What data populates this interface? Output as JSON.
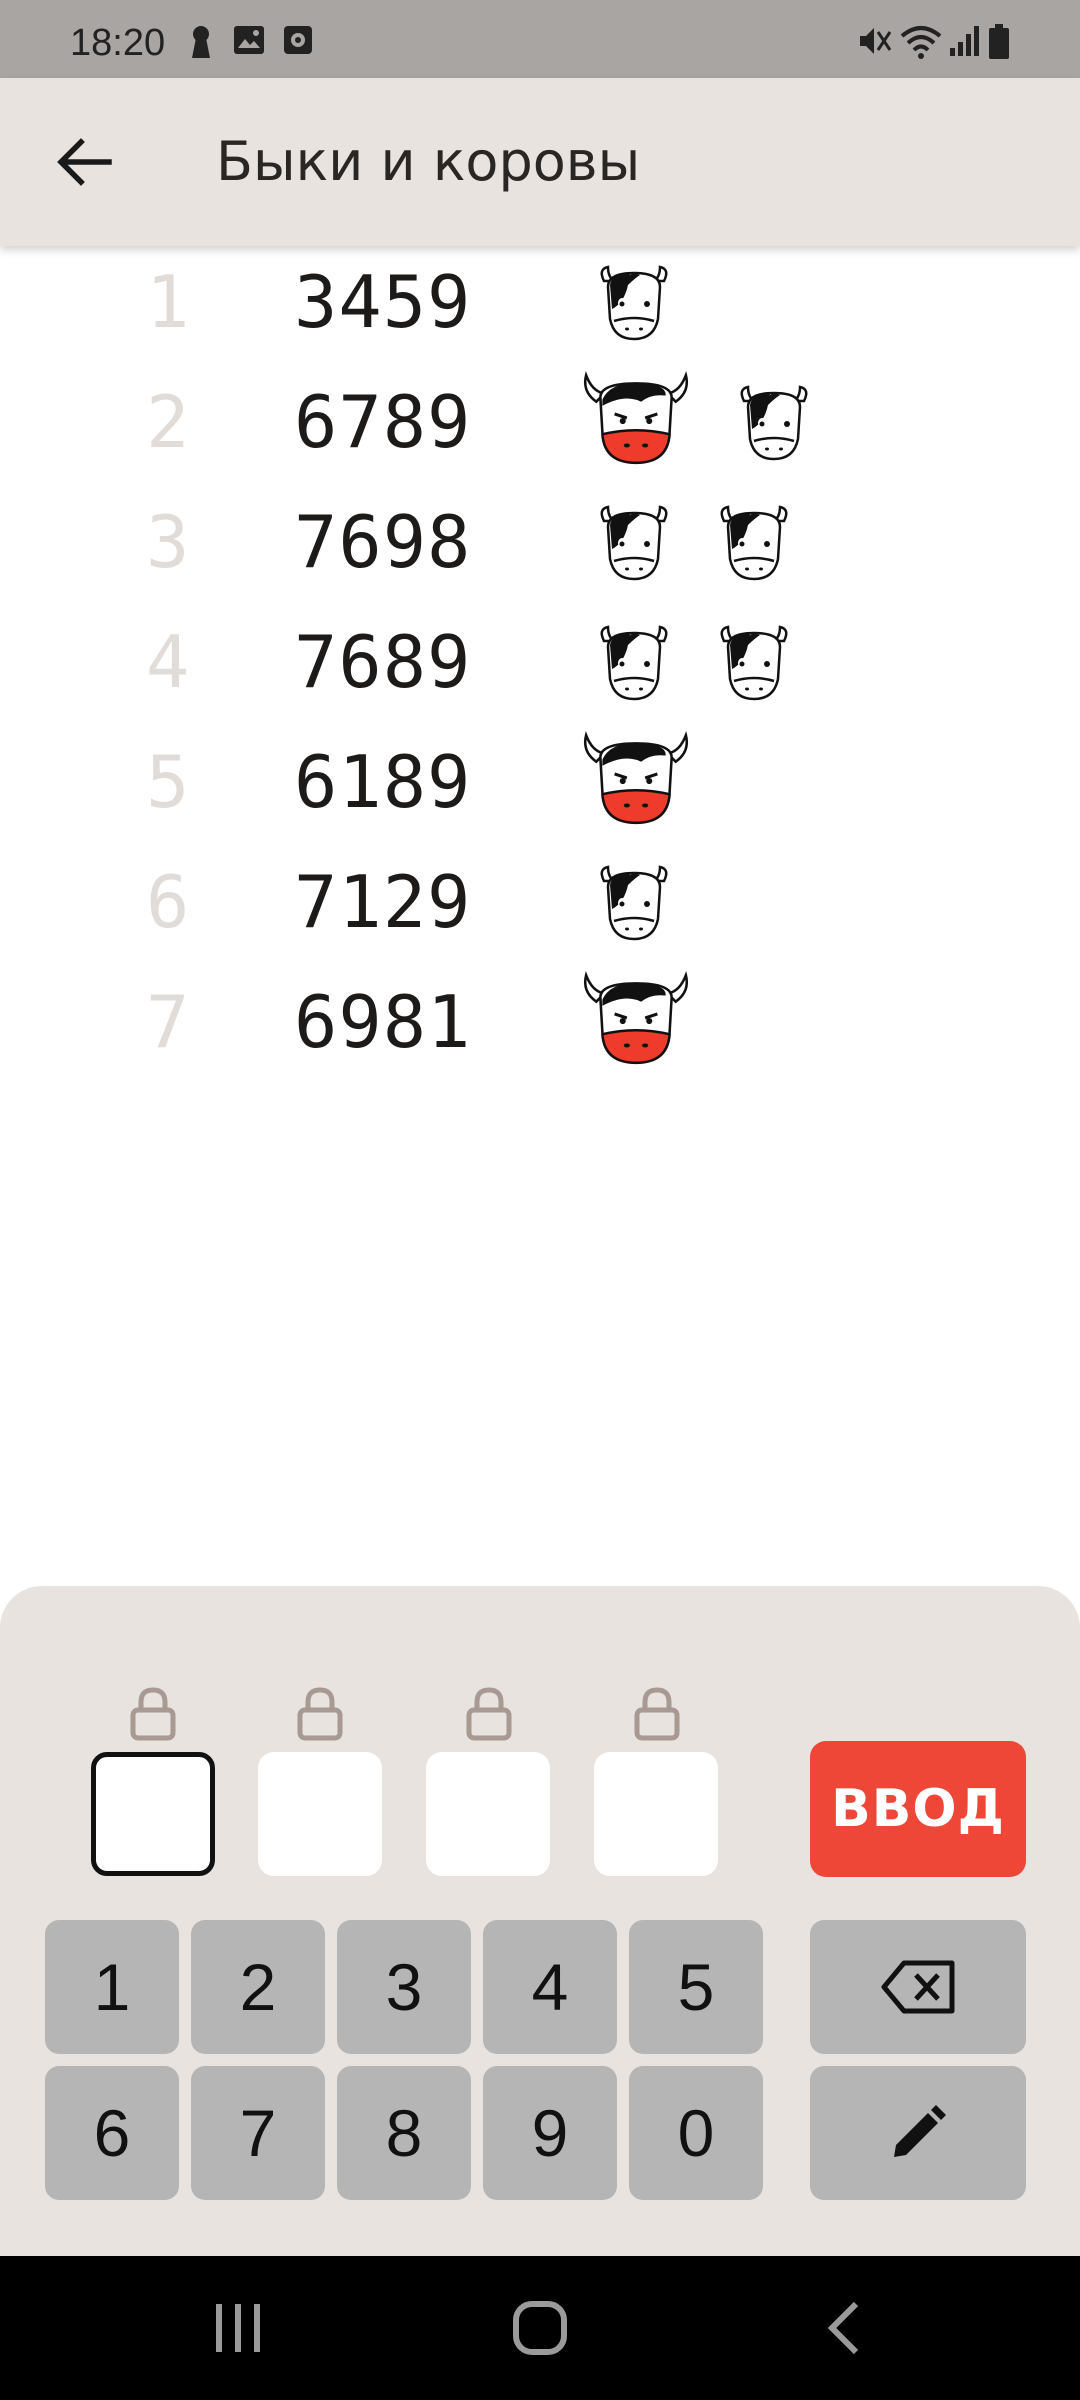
{
  "status_bar": {
    "time": "18:20",
    "left_icons": [
      "keyhole-icon",
      "image-icon",
      "media-icon"
    ],
    "right_icons": [
      "mute-icon",
      "wifi-icon",
      "signal-icon",
      "battery-icon"
    ]
  },
  "app_bar": {
    "title": "Быки и коровы",
    "back_icon": "arrow-left-icon"
  },
  "guesses": [
    {
      "index": "1",
      "number": "3459",
      "bulls": 0,
      "cows": 1
    },
    {
      "index": "2",
      "number": "6789",
      "bulls": 1,
      "cows": 1
    },
    {
      "index": "3",
      "number": "7698",
      "bulls": 0,
      "cows": 2
    },
    {
      "index": "4",
      "number": "7689",
      "bulls": 0,
      "cows": 2
    },
    {
      "index": "5",
      "number": "6189",
      "bulls": 1,
      "cows": 0
    },
    {
      "index": "6",
      "number": "7129",
      "bulls": 0,
      "cows": 1
    },
    {
      "index": "7",
      "number": "6981",
      "bulls": 1,
      "cows": 0
    }
  ],
  "colors": {
    "bull_accent": "#ee3b2b",
    "enter_button": "#ee4637",
    "panel": "#e8e3df",
    "key": "#b5b5b5"
  },
  "input": {
    "slots": [
      "",
      "",
      "",
      ""
    ],
    "active_slot": 0,
    "enter_label": "ВВОД"
  },
  "keypad": {
    "row1": [
      "1",
      "2",
      "3",
      "4",
      "5"
    ],
    "row2": [
      "6",
      "7",
      "8",
      "9",
      "0"
    ],
    "backspace_icon": "backspace-icon",
    "edit_icon": "pencil-icon"
  },
  "nav_bar": {
    "icons": [
      "recent-apps-icon",
      "home-icon",
      "back-icon"
    ]
  }
}
